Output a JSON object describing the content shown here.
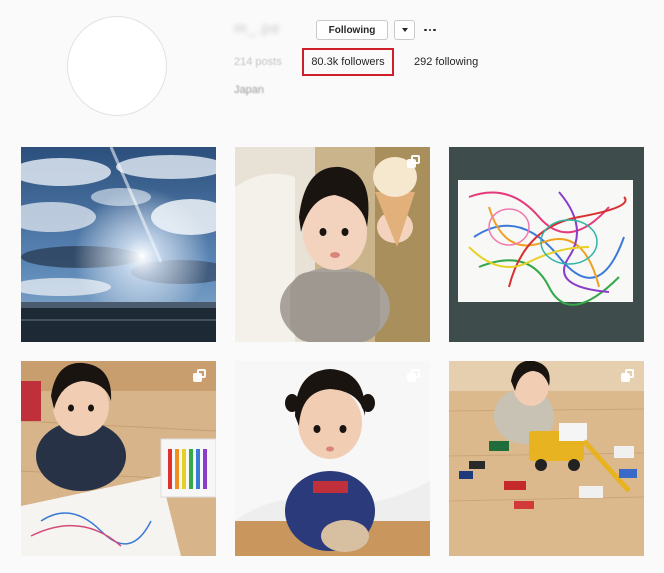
{
  "profile": {
    "username": "m_.pe",
    "follow_button_label": "Following",
    "dropdown_icon": "chevron-down-icon",
    "more_icon": "more-dots-icon",
    "stats": {
      "posts_label": "214 posts",
      "followers_label": "80.3k followers",
      "following_label": "292 following"
    },
    "bio": "Japan"
  },
  "grid": [
    {
      "name": "post-sky-clouds",
      "multi": false
    },
    {
      "name": "post-child-icecream",
      "multi": true
    },
    {
      "name": "post-crayon-drawing",
      "multi": false
    },
    {
      "name": "post-child-crayons",
      "multi": true
    },
    {
      "name": "post-child-pigtails",
      "multi": true
    },
    {
      "name": "post-child-toy-trucks",
      "multi": true
    }
  ],
  "colors": {
    "highlight_border": "#d01f2c",
    "background": "#fafafa"
  }
}
